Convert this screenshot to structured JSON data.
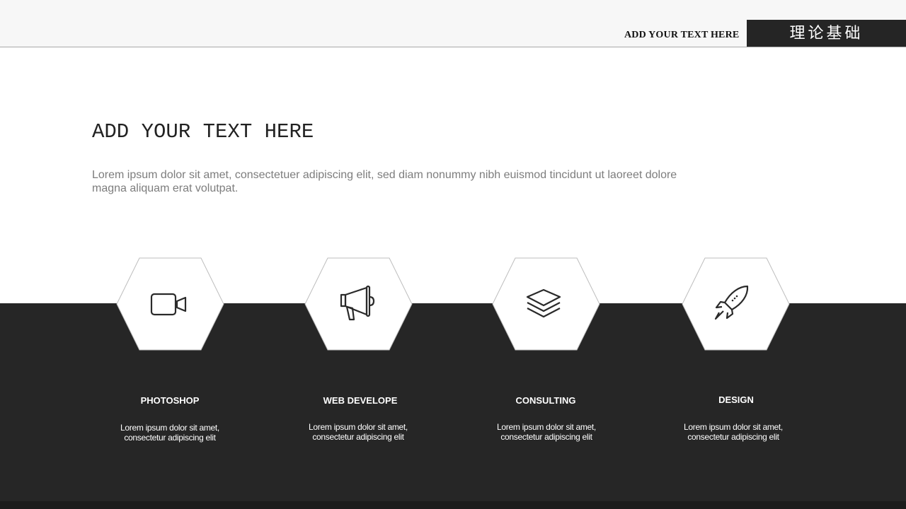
{
  "header": {
    "subtitle": "ADD YOUR TEXT HERE",
    "tab_label": "理论基础"
  },
  "main": {
    "heading": "ADD YOUR TEXT HERE",
    "description": "Lorem ipsum dolor sit amet, consectetuer adipiscing elit, sed diam nonummy nibh euismod tincidunt ut laoreet dolore magna aliquam erat volutpat."
  },
  "cards": [
    {
      "icon": "video-camera-icon",
      "title": "PHOTOSHOP",
      "text_line1": "Lorem ipsum dolor sit amet,",
      "text_line2": "consectetur adipiscing elit"
    },
    {
      "icon": "megaphone-icon",
      "title": "WEB DEVELOPE",
      "text_line1": "Lorem ipsum dolor sit amet,",
      "text_line2": "consectetur adipiscing elit"
    },
    {
      "icon": "layers-icon",
      "title": "CONSULTING",
      "text_line1": "Lorem ipsum dolor sit amet,",
      "text_line2": "consectetur adipiscing elit"
    },
    {
      "icon": "rocket-icon",
      "title": "DESIGN",
      "text_line1": "Lorem ipsum dolor sit amet,",
      "text_line2": "consectetur adipiscing elit"
    }
  ],
  "colors": {
    "dark": "#262626",
    "light": "#f7f7f7",
    "text_gray": "#7d7d7d"
  }
}
